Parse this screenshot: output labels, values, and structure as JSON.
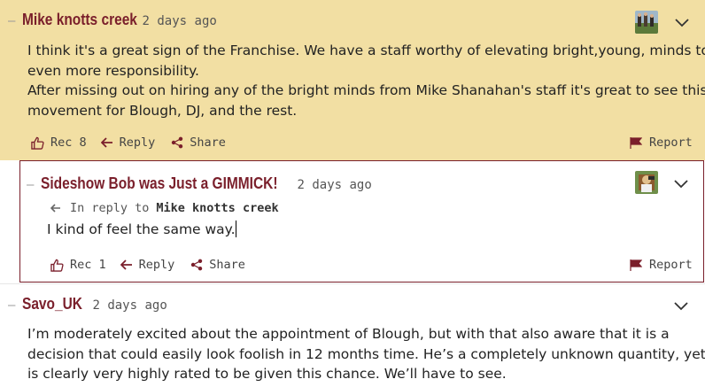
{
  "comments": [
    {
      "author": "Mike knotts creek",
      "time": "2 days ago",
      "body": [
        "I think it's a great sign of the Franchise. We have a staff worthy of elevating bright,young, minds to",
        "even more responsibility.",
        "After missing out on hiring any of the bright minds from Mike Shanahan's staff it's great to see this",
        "movement for Blough, DJ, and the rest."
      ],
      "rec": "Rec 8",
      "reply": "Reply",
      "share": "Share",
      "report": "Report"
    },
    {
      "author": "Sideshow Bob was Just a GIMMICK!",
      "time": "2 days ago",
      "in_reply_label": "In reply to",
      "in_reply_to": "Mike knotts creek",
      "body": [
        "I kind of feel the same way."
      ],
      "rec": "Rec 1",
      "reply": "Reply",
      "share": "Share",
      "report": "Report"
    },
    {
      "author": "Savo_UK",
      "time": "2 days ago",
      "body": [
        "I’m moderately excited about the appointment of Blough, but with that also aware that it is a",
        "decision that could easily look foolish in 12 months time. He’s a completely unknown quantity, yet",
        "is clearly very highly rated to be given this chance. We’ll have to see."
      ]
    }
  ],
  "colors": {
    "accent": "#7a1f2b",
    "highlight_bg": "#f2dfa3"
  },
  "icons": [
    "chevron-down-icon",
    "thumbs-up-icon",
    "reply-arrow-icon",
    "share-icon",
    "flag-icon",
    "avatar"
  ]
}
